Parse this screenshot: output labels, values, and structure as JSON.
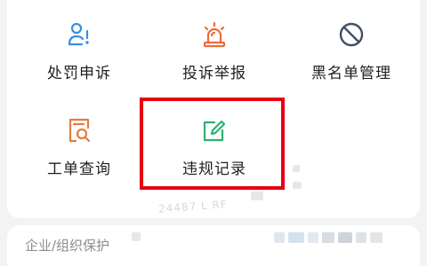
{
  "menu": {
    "items": [
      {
        "label": "处罚申诉",
        "icon": "user-alert-icon",
        "color": "#3a8ee6"
      },
      {
        "label": "投诉举报",
        "icon": "siren-icon",
        "color": "#f06a3a"
      },
      {
        "label": "黑名单管理",
        "icon": "ban-icon",
        "color": "#3f4f66"
      },
      {
        "label": "工单查询",
        "icon": "doc-search-icon",
        "color": "#ea7a3a"
      },
      {
        "label": "违规记录",
        "icon": "edit-note-icon",
        "color": "#2fb170"
      }
    ]
  },
  "highlight": {
    "color": "#e60012",
    "target": "违规记录"
  },
  "section": {
    "title": "企业/组织保护"
  },
  "watermark": {
    "text": "24487 L RF"
  }
}
